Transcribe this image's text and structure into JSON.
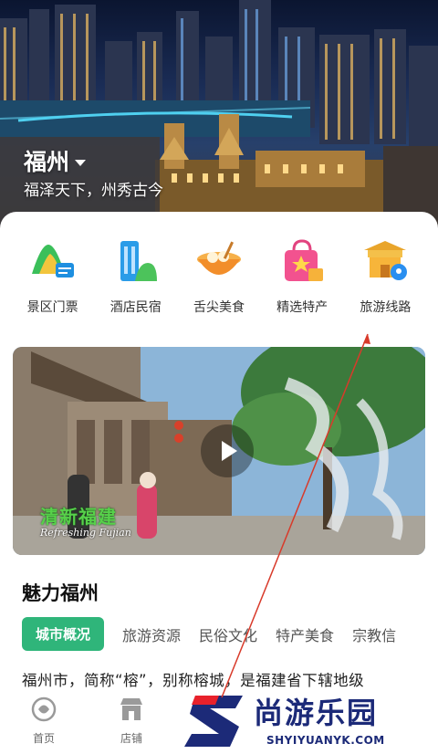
{
  "hero": {
    "city": "福州",
    "slogan": "福泽天下，州秀古今"
  },
  "categories": [
    {
      "label": "景区门票",
      "icon": "scenic-ticket-icon"
    },
    {
      "label": "酒店民宿",
      "icon": "hotel-icon"
    },
    {
      "label": "舌尖美食",
      "icon": "food-bowl-icon"
    },
    {
      "label": "精选特产",
      "icon": "shopping-bag-icon"
    },
    {
      "label": "旅游线路",
      "icon": "travel-route-icon"
    }
  ],
  "video": {
    "logo_cn": "清新福建",
    "logo_en": "Refreshing Fujian"
  },
  "section": {
    "title": "魅力福州",
    "tabs": [
      "城市概况",
      "旅游资源",
      "民俗文化",
      "特产美食",
      "宗教信"
    ],
    "active_tab": "城市概况",
    "description": "福州市，简称“榕”，别称榕城，是福建省下辖地级"
  },
  "nav": [
    {
      "label": "首页",
      "icon": "home-icon"
    },
    {
      "label": "店铺",
      "icon": "store-icon"
    }
  ],
  "watermark": {
    "text": "尚游乐园",
    "url": "SHYIYUANYK.COM"
  },
  "colors": {
    "accent": "#2fb57a",
    "watermark": "#1c2a78",
    "watermark_red": "#e8212b"
  }
}
